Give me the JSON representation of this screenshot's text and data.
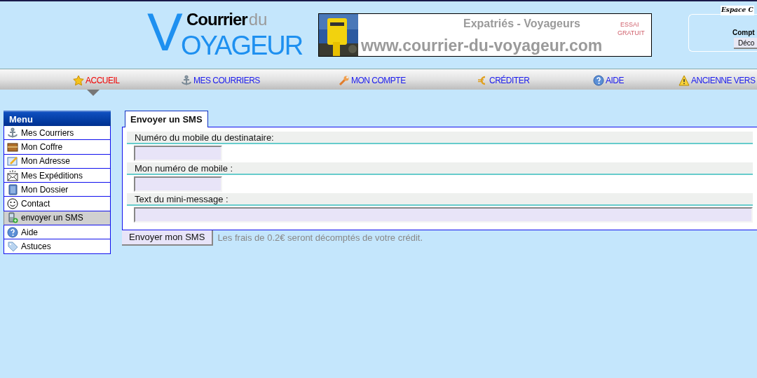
{
  "logo": {
    "initial": "V",
    "word_1": "Courrier",
    "word_2": "du",
    "word_3": "OYAGEUR"
  },
  "banner": {
    "title": "Expatriés - Voyageurs",
    "url": "www.courrier-du-voyageur.com",
    "badge_1": "ESSAI",
    "badge_2": "GRATUIT"
  },
  "account_panel": {
    "title": "Espace C",
    "label": "Compt",
    "button": "Déco"
  },
  "nav": [
    {
      "label": "ACCUEIL",
      "selected": true
    },
    {
      "label": "MES COURRIERS",
      "selected": false
    },
    {
      "label": "MON COMPTE",
      "selected": false
    },
    {
      "label": "CRÉDITER",
      "selected": false
    },
    {
      "label": "AIDE",
      "selected": false
    },
    {
      "label": "ANCIENNE VERS",
      "selected": false
    }
  ],
  "sidebar": {
    "title": "Menu",
    "items": [
      {
        "label": "Mes Courriers",
        "selected": false
      },
      {
        "label": "Mon Coffre",
        "selected": false
      },
      {
        "label": "Mon Adresse",
        "selected": false
      },
      {
        "label": "Mes Expéditions",
        "selected": false
      },
      {
        "label": "Mon Dossier",
        "selected": false
      },
      {
        "label": "Contact",
        "selected": false
      },
      {
        "label": "envoyer un SMS",
        "selected": true
      },
      {
        "label": "Aide",
        "selected": false
      },
      {
        "label": "Astuces",
        "selected": false
      }
    ]
  },
  "form": {
    "tab": "Envoyer un SMS",
    "fields": [
      {
        "label": "Numéro du mobile du destinataire:",
        "kind": "short"
      },
      {
        "label": "Mon numéro de mobile :",
        "kind": "short"
      },
      {
        "label": "Text du mini-message :",
        "kind": "long"
      }
    ],
    "submit": "Envoyer mon SMS",
    "note": "Les frais de 0.2€ seront décomptés de votre crédit."
  }
}
